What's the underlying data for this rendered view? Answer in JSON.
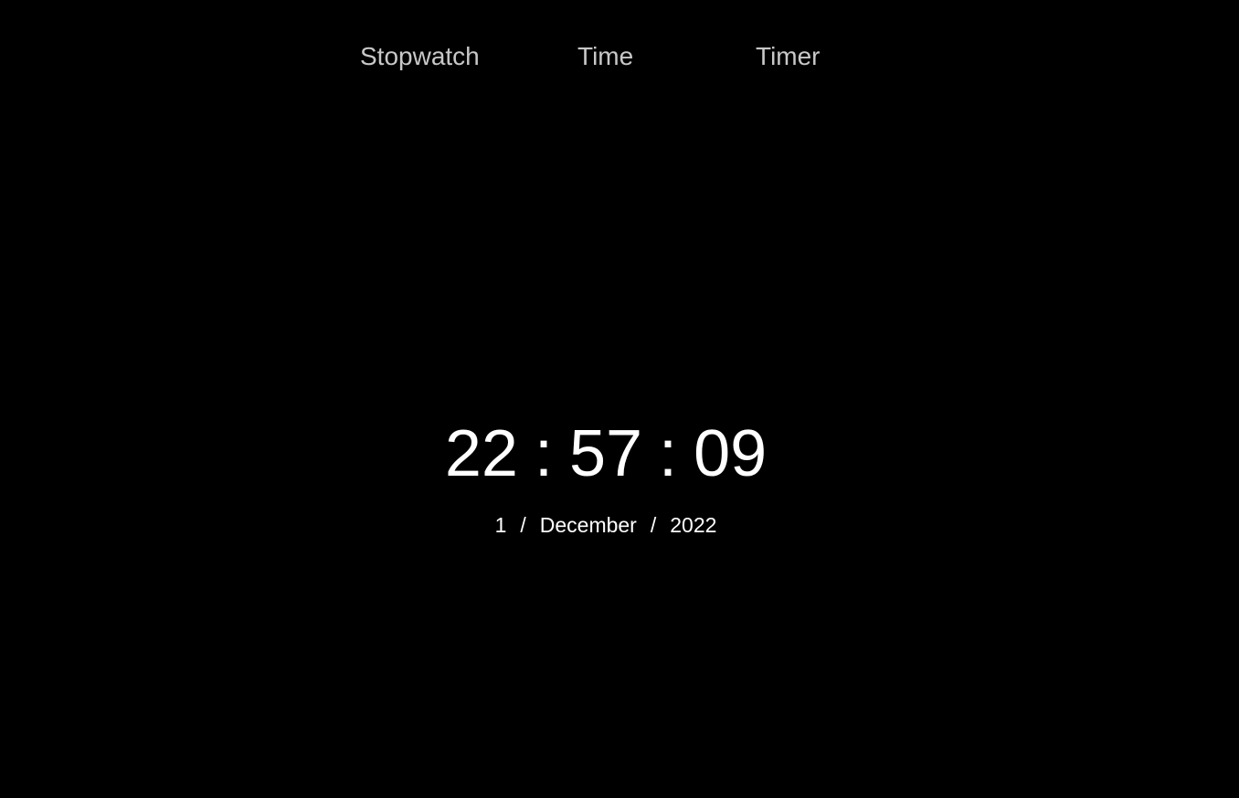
{
  "nav": {
    "tabs": [
      {
        "label": "Stopwatch"
      },
      {
        "label": "Time"
      },
      {
        "label": "Timer"
      }
    ]
  },
  "clock": {
    "hours": "22",
    "minutes": "57",
    "seconds": "09",
    "separator": ":"
  },
  "date": {
    "day": "1",
    "month": "December",
    "year": "2022",
    "separator": "/"
  },
  "colors": {
    "background": "#000000",
    "nav_text": "#c8c8c8",
    "clock_text": "#ffffff"
  }
}
